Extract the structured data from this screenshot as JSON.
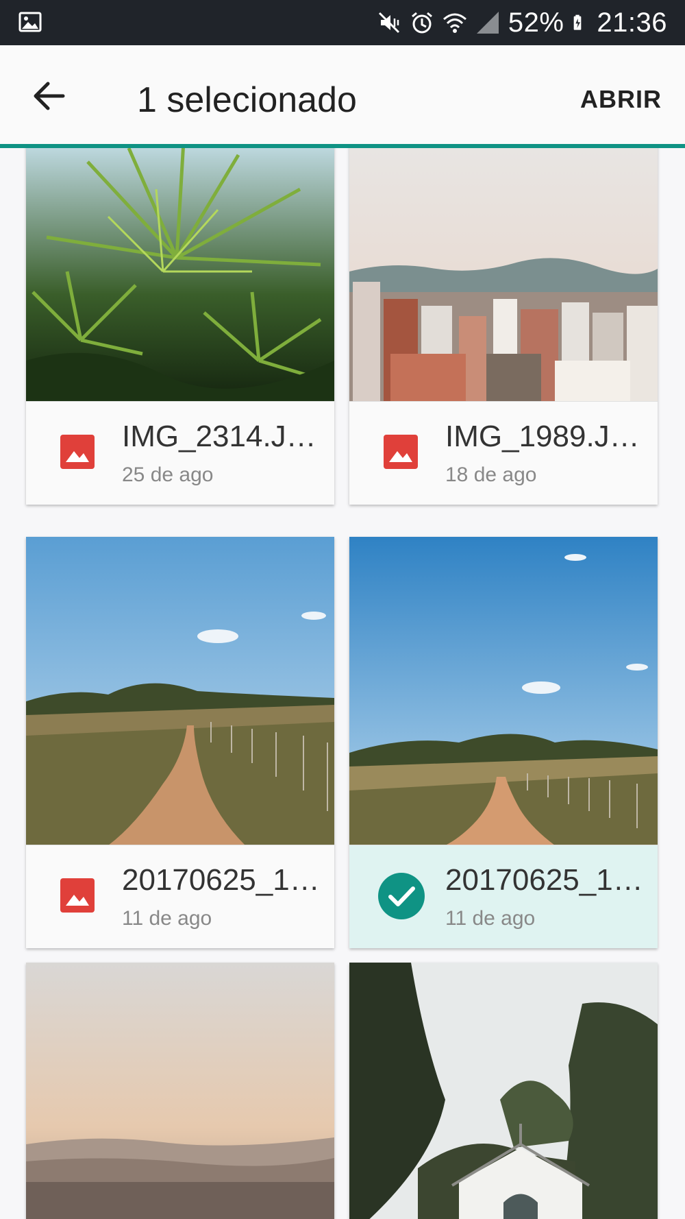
{
  "status_bar": {
    "battery": "52%",
    "time": "21:36",
    "icons": [
      "image-icon",
      "mute-vibrate-icon",
      "alarm-icon",
      "wifi-icon",
      "signal-icon",
      "battery-charging-icon"
    ]
  },
  "app_bar": {
    "title": "1 selecionado",
    "open_label": "ABRIR",
    "accent_color": "#0f9384"
  },
  "files": [
    {
      "name": "IMG_2314.J…",
      "date": "25 de ago",
      "selected": false,
      "photo": "palm-leaves"
    },
    {
      "name": "IMG_1989.J…",
      "date": "18 de ago",
      "selected": false,
      "photo": "city-skyline"
    },
    {
      "name": "20170625_1…",
      "date": "11 de ago",
      "selected": false,
      "photo": "dirt-road-field"
    },
    {
      "name": "20170625_1…",
      "date": "11 de ago",
      "selected": true,
      "photo": "dirt-road-field"
    },
    {
      "name": "",
      "date": "",
      "selected": false,
      "photo": "hazy-sunset-city"
    },
    {
      "name": "",
      "date": "",
      "selected": false,
      "photo": "trees-chapel"
    }
  ]
}
